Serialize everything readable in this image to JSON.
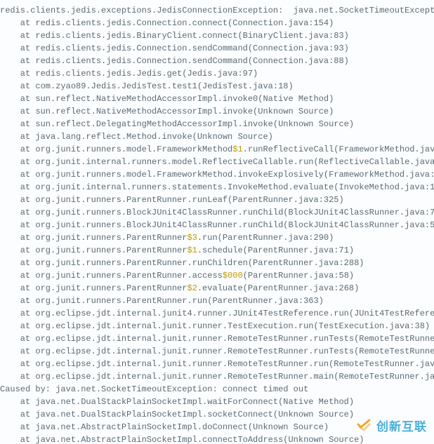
{
  "exception_prefix": "redis.clients.jedis.exceptions.JedisConnectionException:  ",
  "exception_cause": "java.net.SocketTimeoutExceptio",
  "frames": [
    "    at redis.clients.jedis.Connection.connect(Connection.java:154)",
    "    at redis.clients.jedis.BinaryClient.connect(BinaryClient.java:83)",
    "    at redis.clients.jedis.Connection.sendCommand(Connection.java:93)",
    "    at redis.clients.jedis.Connection.sendCommand(Connection.java:88)",
    "    at redis.clients.jedis.Jedis.get(Jedis.java:97)",
    "    at com.zyao89.Jedis.JedisTest.test1(JedisTest.java:18)",
    "    at sun.reflect.NativeMethodAccessorImpl.invoke0(Native Method)",
    "    at sun.reflect.NativeMethodAccessorImpl.invoke(Unknown Source)",
    "    at sun.reflect.DelegatingMethodAccessorImpl.invoke(Unknown Source)",
    "    at java.lang.reflect.Method.invoke(Unknown Source)"
  ],
  "frame_fw_pre": "    at org.junit.runners.model.FrameworkMethod",
  "frame_fw_tok": "$1",
  "frame_fw_post": ".runReflectiveCall(FrameworkMethod.jav",
  "frames2": [
    "    at org.junit.internal.runners.model.ReflectiveCallable.run(ReflectiveCallable.java",
    "    at org.junit.runners.model.FrameworkMethod.invokeExplosively(FrameworkMethod.java:",
    "    at org.junit.internal.runners.statements.InvokeMethod.evaluate(InvokeMethod.java:1",
    "    at org.junit.runners.ParentRunner.runLeaf(ParentRunner.java:325)",
    "    at org.junit.runners.BlockJUnit4ClassRunner.runChild(BlockJUnit4ClassRunner.java:7",
    "    at org.junit.runners.BlockJUnit4ClassRunner.runChild(BlockJUnit4ClassRunner.java:5"
  ],
  "pr3_pre": "    at org.junit.runners.ParentRunner",
  "pr3_tok": "$3",
  "pr3_post": ".run(ParentRunner.java:290)",
  "pr1_pre": "    at org.junit.runners.ParentRunner",
  "pr1_tok": "$1",
  "pr1_post": ".schedule(ParentRunner.java:71)",
  "frames3": [
    "    at org.junit.runners.ParentRunner.runChildren(ParentRunner.java:288)"
  ],
  "acc_pre": "    at org.junit.runners.ParentRunner.access",
  "acc_tok": "$000",
  "acc_post": "(ParentRunner.java:58)",
  "pr2_pre": "    at org.junit.runners.ParentRunner",
  "pr2_tok": "$2",
  "pr2_post": ".evaluate(ParentRunner.java:268)",
  "frames4": [
    "    at org.junit.runners.ParentRunner.run(ParentRunner.java:363)",
    "    at org.eclipse.jdt.internal.junit4.runner.JUnit4TestReference.run(JUnit4TestRefere",
    "    at org.eclipse.jdt.internal.junit.runner.TestExecution.run(TestExecution.java:38)",
    "    at org.eclipse.jdt.internal.junit.runner.RemoteTestRunner.runTests(RemoteTestRunne",
    "    at org.eclipse.jdt.internal.junit.runner.RemoteTestRunner.runTests(RemoteTestRunne",
    "    at org.eclipse.jdt.internal.junit.runner.RemoteTestRunner.run(RemoteTestRunner.jav",
    "    at org.eclipse.jdt.internal.junit.runner.RemoteTestRunner.main(RemoteTestRunner.ja"
  ],
  "caused_by": "Caused by: java.net.SocketTimeoutException: connect timed out",
  "frames5": [
    "    at java.net.DualStackPlainSocketImpl.waitForConnect(Native Method)",
    "    at java.net.DualStackPlainSocketImpl.socketConnect(Unknown Source)",
    "    at java.net.AbstractPlainSocketImpl.doConnect(Unknown Source)",
    "    at java.net.AbstractPlainSocketImpl.connectToAddress(Unknown Source)"
  ],
  "watermark_text": "创新互联",
  "colors": {
    "text": "#5c6a74",
    "token": "#c29b00",
    "watermark": "#3aa6d6"
  }
}
